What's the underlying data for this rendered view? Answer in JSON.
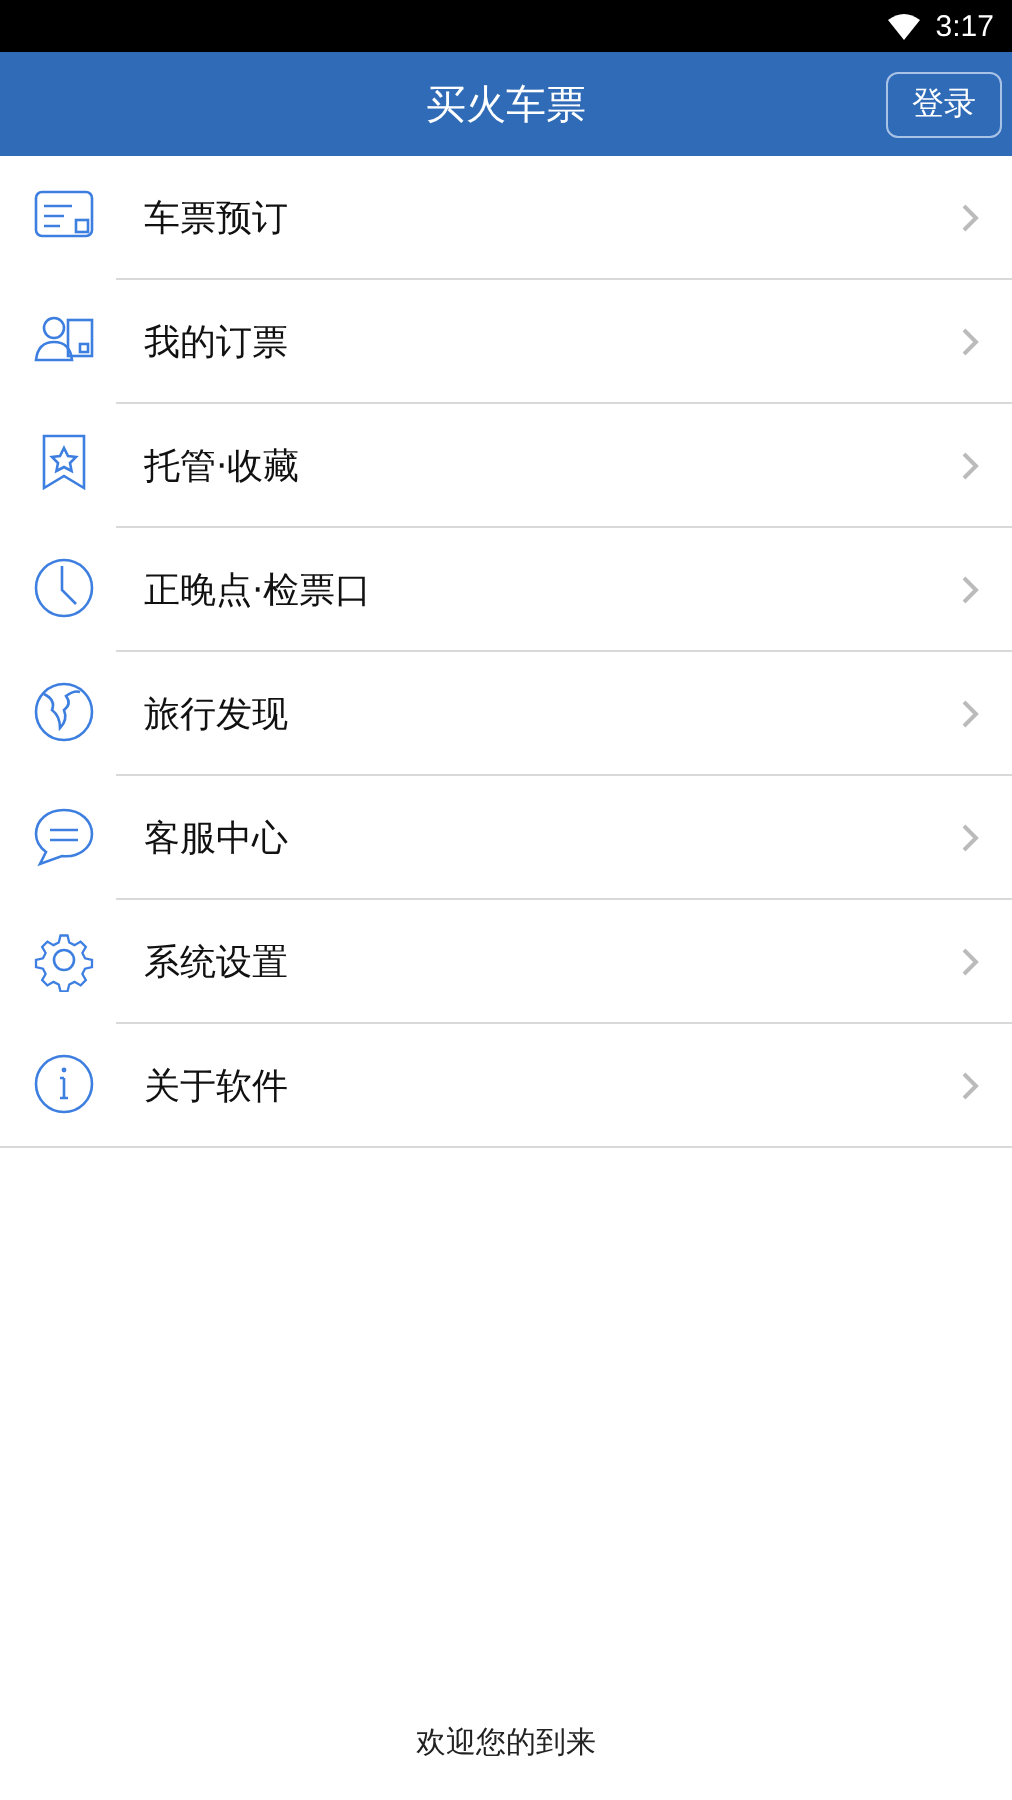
{
  "status_bar": {
    "time": "3:17"
  },
  "header": {
    "title": "买火车票",
    "login_button": "登录"
  },
  "menu": [
    {
      "label": "车票预订"
    },
    {
      "label": "我的订票"
    },
    {
      "label": "托管·收藏"
    },
    {
      "label": "正晚点·检票口"
    },
    {
      "label": "旅行发现"
    },
    {
      "label": "客服中心"
    },
    {
      "label": "系统设置"
    },
    {
      "label": "关于软件"
    }
  ],
  "footer": {
    "text": "欢迎您的到来"
  }
}
